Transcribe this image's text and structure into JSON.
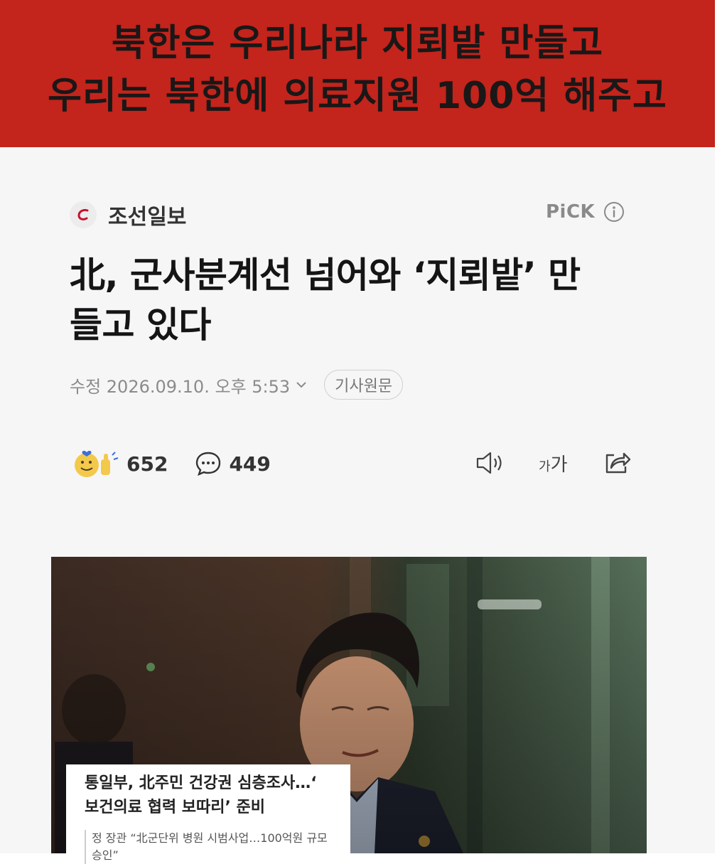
{
  "banner": {
    "line1": "북한은 우리나라 지뢰밭 만들고",
    "line2": "우리는 북한에 의료지원 100억 해주고"
  },
  "article": {
    "publisher": "조선일보",
    "pick_label": "PiCK",
    "headline_line1": "北, 군사분계선 넘어와 ‘지뢰밭’ 만",
    "headline_line2": "들고 있다",
    "date_text": "수정 2026.09.10. 오후 5:53",
    "original_button": "기사원문",
    "reactions": {
      "like_count": "652",
      "comment_count": "449"
    },
    "font_size_small": "가",
    "font_size_large": "가"
  },
  "photo": {
    "caption_title_line1": "통일부, 北주민 건강권 심층조사…‘",
    "caption_title_line2": "보건의료 협력 보따리’ 준비",
    "caption_sub": "정 장관 “北군단위 병원 시범사업…100억원 규모 승인”"
  },
  "colors": {
    "banner_bg": "#c3241c",
    "article_bg": "#f6f6f7",
    "brand_red": "#c8102e"
  }
}
